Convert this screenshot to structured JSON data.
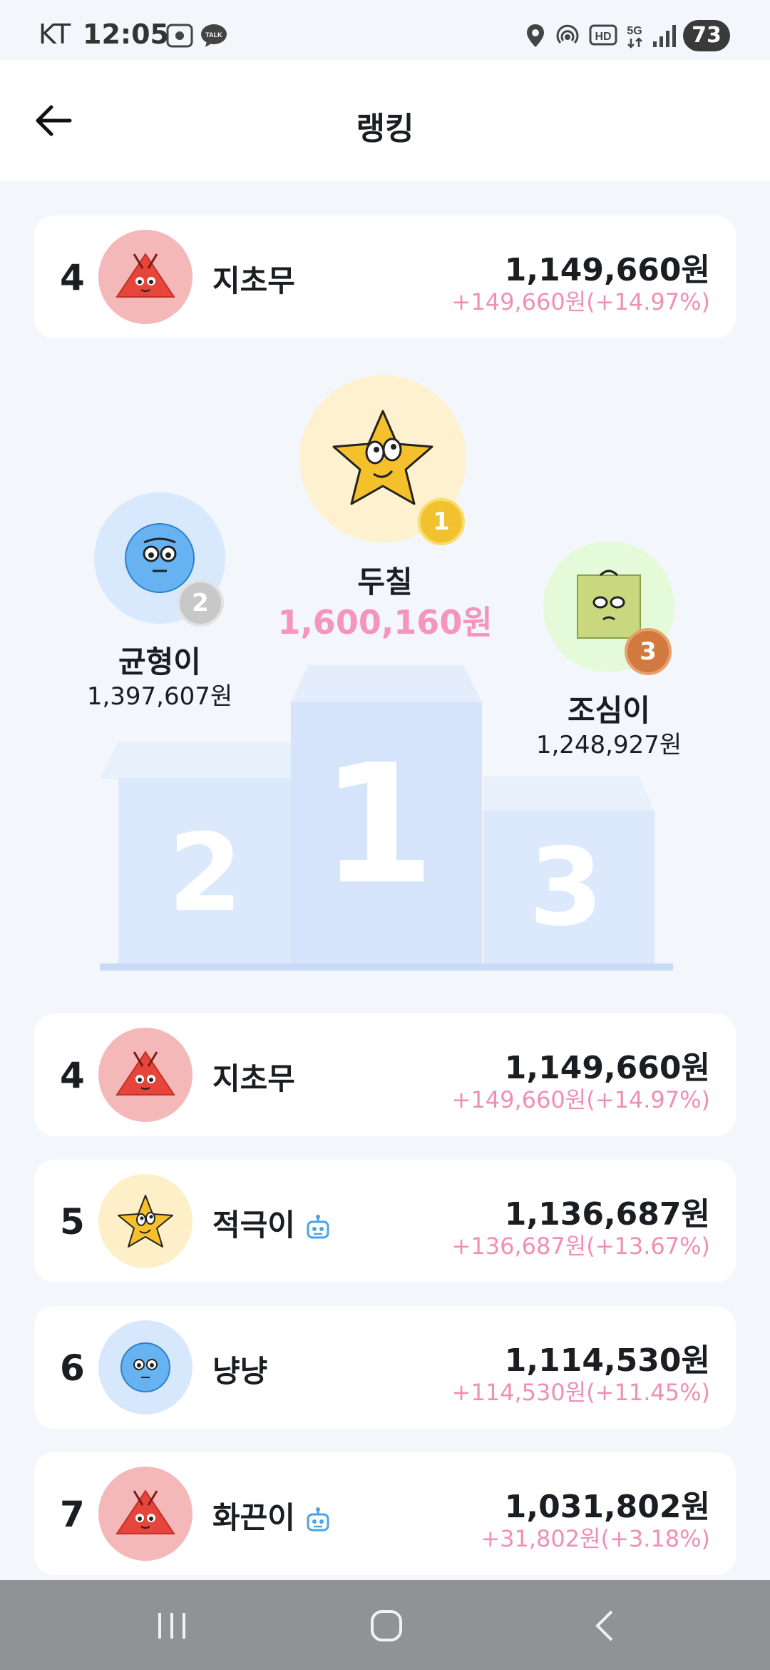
{
  "status_bar": {
    "carrier": "KT",
    "time": "12:05",
    "battery": "73",
    "icons": [
      "screenshot-icon",
      "talk-icon",
      "location-icon",
      "hotspot-icon",
      "hd-icon",
      "5g-icon",
      "signal-icon",
      "battery-icon"
    ],
    "talk_label": "TALK",
    "hd_label": "HD",
    "fiveg_label": "5G"
  },
  "header": {
    "title": "랭킹",
    "back_icon": "arrow-left-icon"
  },
  "my_rank": {
    "rank": "4",
    "name": "지초무",
    "amount": "1,149,660원",
    "gain": "+149,660원(+14.97%)",
    "avatar": "red-triangle-character"
  },
  "podium": {
    "first": {
      "rank": "1",
      "name": "두칠",
      "amount": "1,600,160원",
      "avatar": "yellow-star-character"
    },
    "second": {
      "rank": "2",
      "name": "균형이",
      "amount": "1,397,607원",
      "avatar": "blue-ball-character"
    },
    "third": {
      "rank": "3",
      "name": "조심이",
      "amount": "1,248,927원",
      "avatar": "green-square-character"
    },
    "block_labels": [
      "2",
      "1",
      "3"
    ]
  },
  "ranking_list": [
    {
      "rank": "4",
      "name": "지초무",
      "amount": "1,149,660원",
      "gain": "+149,660원(+14.97%)",
      "bot": false,
      "avatar": "red-triangle-character"
    },
    {
      "rank": "5",
      "name": "적극이",
      "amount": "1,136,687원",
      "gain": "+136,687원(+13.67%)",
      "bot": true,
      "avatar": "yellow-star-character"
    },
    {
      "rank": "6",
      "name": "냥냥",
      "amount": "1,114,530원",
      "gain": "+114,530원(+11.45%)",
      "bot": false,
      "avatar": "blue-ball-character"
    },
    {
      "rank": "7",
      "name": "화끈이",
      "amount": "1,031,802원",
      "gain": "+31,802원(+3.18%)",
      "bot": true,
      "avatar": "red-triangle-character"
    }
  ],
  "colors": {
    "accent_pink": "#f08fb4",
    "gold": "#f2c12e",
    "silver": "#c8c8c8",
    "bronze": "#d2793f",
    "podium_blue": "#dce9fc"
  },
  "nav": {
    "icons": [
      "recent-apps-icon",
      "home-icon",
      "back-icon"
    ]
  }
}
